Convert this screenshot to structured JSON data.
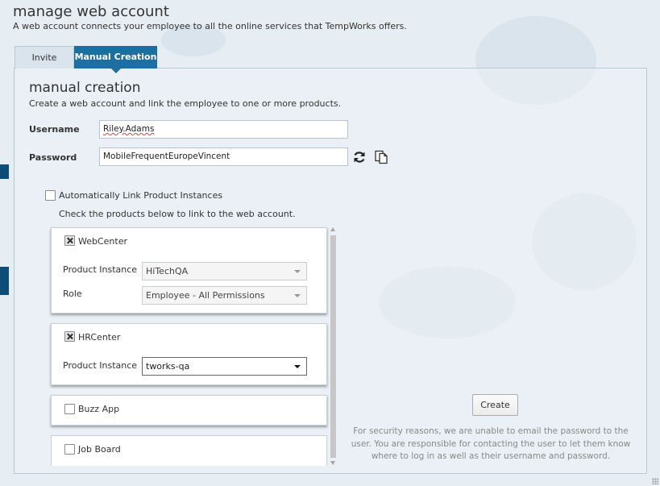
{
  "header": {
    "title": "manage web account",
    "subtitle": "A web account connects your employee to all the online services that TempWorks offers."
  },
  "tabs": [
    {
      "label": "Invite",
      "active": false
    },
    {
      "label": "Manual Creation",
      "active": true
    }
  ],
  "section": {
    "title": "manual creation",
    "subtitle": "Create a web account and link the employee to one or more products."
  },
  "form": {
    "username_label": "Username",
    "username_value": "Riley.Adams",
    "password_label": "Password",
    "password_value": "MobileFrequentEuropeVincent",
    "refresh_icon": "refresh-icon",
    "copy_icon": "copy-icon"
  },
  "auto_link": {
    "label": "Automatically Link Product Instances",
    "checked": false
  },
  "products_hint": "Check the products below to link to the web account.",
  "products": [
    {
      "name": "WebCenter",
      "checked": true,
      "instance_label": "Product Instance",
      "instance_value": "HiTechQA",
      "role_label": "Role",
      "role_value": "Employee - All Permissions"
    },
    {
      "name": "HRCenter",
      "checked": true,
      "instance_label": "Product Instance",
      "instance_value": "tworks-qa"
    },
    {
      "name": "Buzz App",
      "checked": false
    },
    {
      "name": "Job Board",
      "checked": false
    }
  ],
  "create_button": "Create",
  "security_note": "For security reasons, we are unable to email the password to the user.  You are responsible for contacting the user to let them know where to log in as well as their username and password.",
  "colors": {
    "accent": "#1d6fa1",
    "side_marker": "#0e4d78",
    "background": "#e6edf3"
  }
}
